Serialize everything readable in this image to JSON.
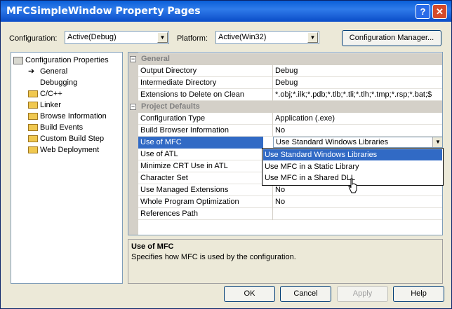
{
  "window": {
    "title": "MFCSimpleWindow Property Pages",
    "help_glyph": "?",
    "close_glyph": "✕"
  },
  "config": {
    "configuration_label": "Configuration:",
    "configuration_value": "Active(Debug)",
    "platform_label": "Platform:",
    "platform_value": "Active(Win32)",
    "manager_button": "Configuration Manager..."
  },
  "tree": {
    "root": "Configuration Properties",
    "items": [
      "General",
      "Debugging",
      "C/C++",
      "Linker",
      "Browse Information",
      "Build Events",
      "Custom Build Step",
      "Web Deployment"
    ]
  },
  "grid": {
    "cat1": "General",
    "cat2": "Project Defaults",
    "rows": [
      {
        "name": "Output Directory",
        "value": "Debug"
      },
      {
        "name": "Intermediate Directory",
        "value": "Debug"
      },
      {
        "name": "Extensions to Delete on Clean",
        "value": "*.obj;*.ilk;*.pdb;*.tlb;*.tli;*.tlh;*.tmp;*.rsp;*.bat;$"
      },
      {
        "name": "Configuration Type",
        "value": "Application (.exe)"
      },
      {
        "name": "Build Browser Information",
        "value": "No"
      },
      {
        "name": "Use of MFC",
        "value": "Use Standard Windows Libraries"
      },
      {
        "name": "Use of ATL",
        "value": ""
      },
      {
        "name": "Minimize CRT Use in ATL",
        "value": ""
      },
      {
        "name": "Character Set",
        "value": ""
      },
      {
        "name": "Use Managed Extensions",
        "value": "No"
      },
      {
        "name": "Whole Program Optimization",
        "value": "No"
      },
      {
        "name": "References Path",
        "value": ""
      }
    ]
  },
  "dropdown": {
    "options": [
      "Use Standard Windows Libraries",
      "Use MFC in a Static Library",
      "Use MFC in a Shared DLL"
    ]
  },
  "description": {
    "title": "Use of MFC",
    "text": "Specifies how MFC is used by the configuration."
  },
  "buttons": {
    "ok": "OK",
    "cancel": "Cancel",
    "apply": "Apply",
    "help": "Help"
  }
}
